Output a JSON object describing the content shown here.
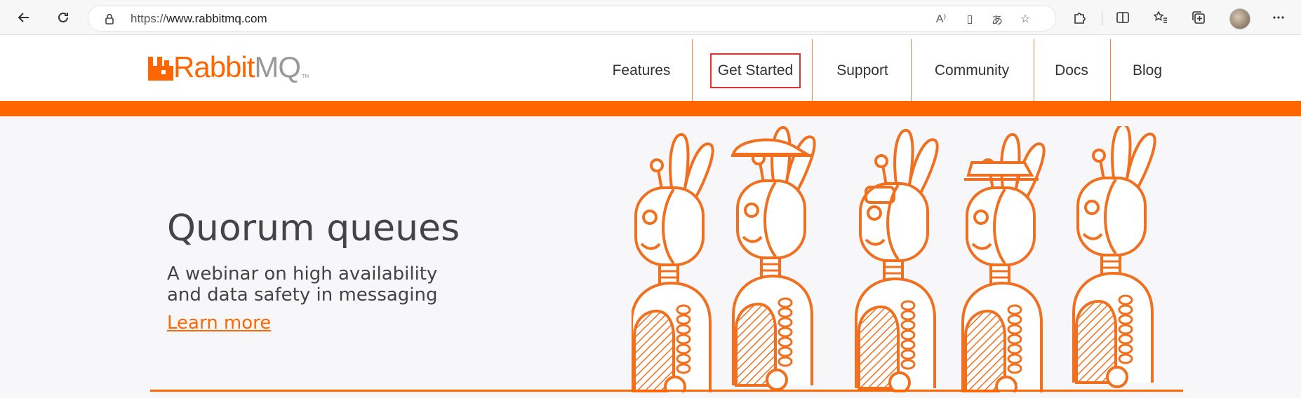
{
  "browser": {
    "url_scheme": "https://",
    "url_host": "www.rabbitmq.com"
  },
  "site": {
    "logo_part1": "Rabbit",
    "logo_part2": "MQ",
    "logo_tm": "TM",
    "nav": [
      "Features",
      "Get Started",
      "Support",
      "Community",
      "Docs",
      "Blog"
    ],
    "highlighted_nav": "Get Started"
  },
  "hero": {
    "title": "Quorum queues",
    "subtitle_line1": "A webinar on high availability",
    "subtitle_line2": "and data safety in messaging",
    "link": "Learn more"
  },
  "colors": {
    "brand_orange": "#ff6600",
    "highlight_red": "#e03030"
  }
}
